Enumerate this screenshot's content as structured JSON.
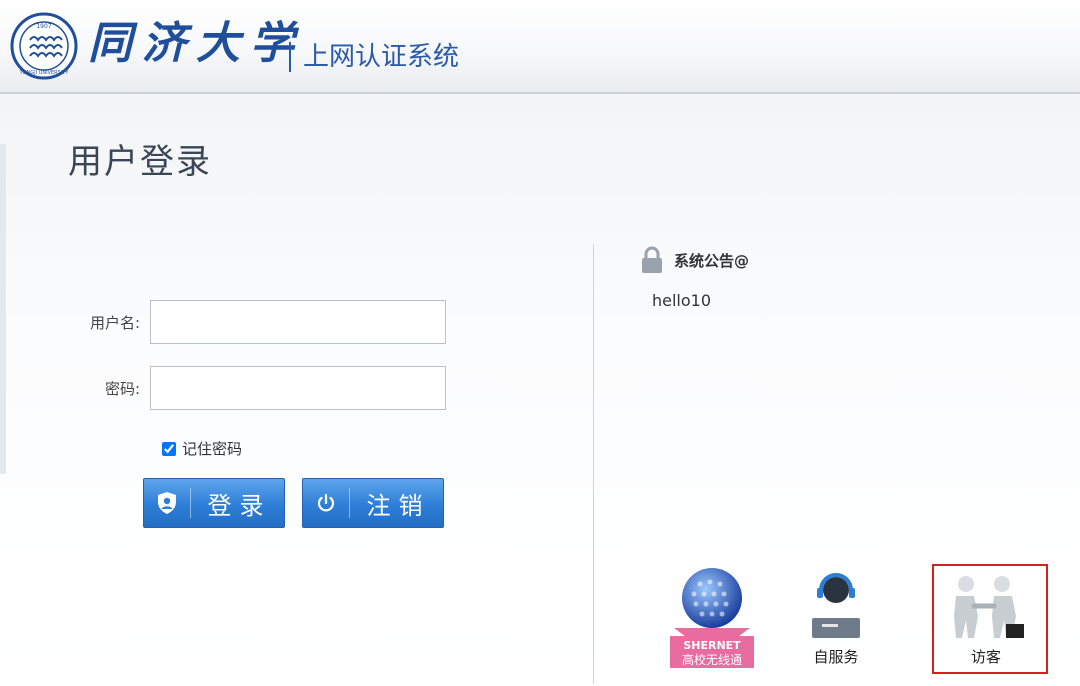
{
  "header": {
    "logo_text": "同济大学",
    "seal_year": "1907",
    "seal_text": "TONGJI UNIVERSITY",
    "system_name": "上网认证系统"
  },
  "page_title": "用户登录",
  "login_form": {
    "username_label": "用户名:",
    "username_value": "",
    "password_label": "密码:",
    "password_value": "",
    "remember_label": "记住密码",
    "remember_checked": true,
    "login_button": "登录",
    "logout_button": "注销"
  },
  "notice": {
    "title": "系统公告@",
    "body": "hello10"
  },
  "shortcuts": {
    "shernet_brand": "SHERNET",
    "shernet_sub": "高校无线通",
    "self_service_label": "自服务",
    "guest_label": "访客"
  },
  "colors": {
    "brand_blue": "#1f4e9a",
    "button_blue": "#2d7ed6",
    "highlight_red": "#d62020"
  }
}
